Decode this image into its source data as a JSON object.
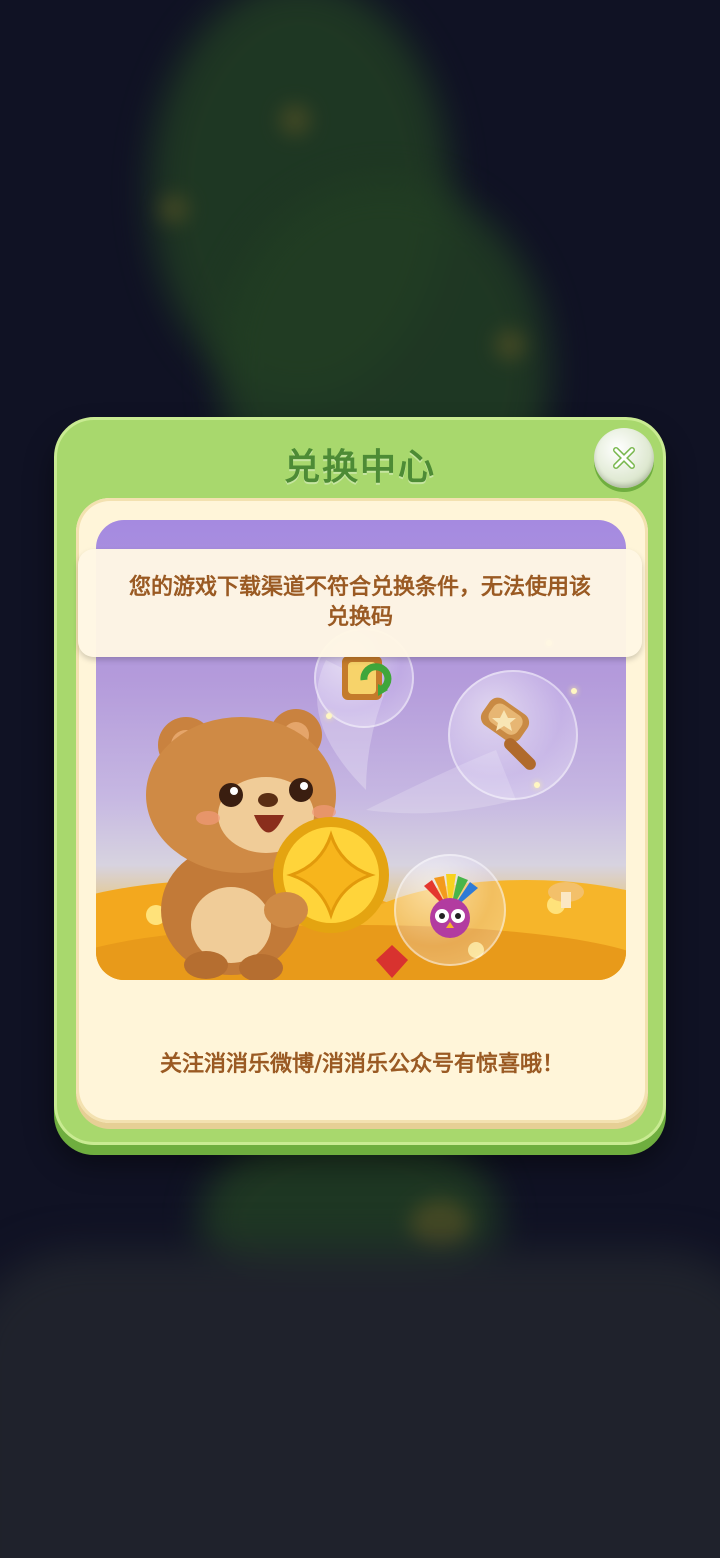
{
  "dialog": {
    "title": "兑换中心",
    "close_icon": "close-icon",
    "footer": "关注消消乐微博/消消乐公众号有惊喜哦！"
  },
  "toast": {
    "message": "您的游戏下载渠道不符合兑换条件，无法使用该兑换码"
  },
  "illustration": {
    "character": "bear-holding-coin",
    "items": [
      "refresh-booster-icon",
      "hammer-booster-icon",
      "rainbow-bird-icon"
    ]
  },
  "colors": {
    "dialog_green": "#a8d86d",
    "title_green": "#4d8b35",
    "panel_cream": "#fff5d9",
    "text_brown": "#9a5a23"
  }
}
